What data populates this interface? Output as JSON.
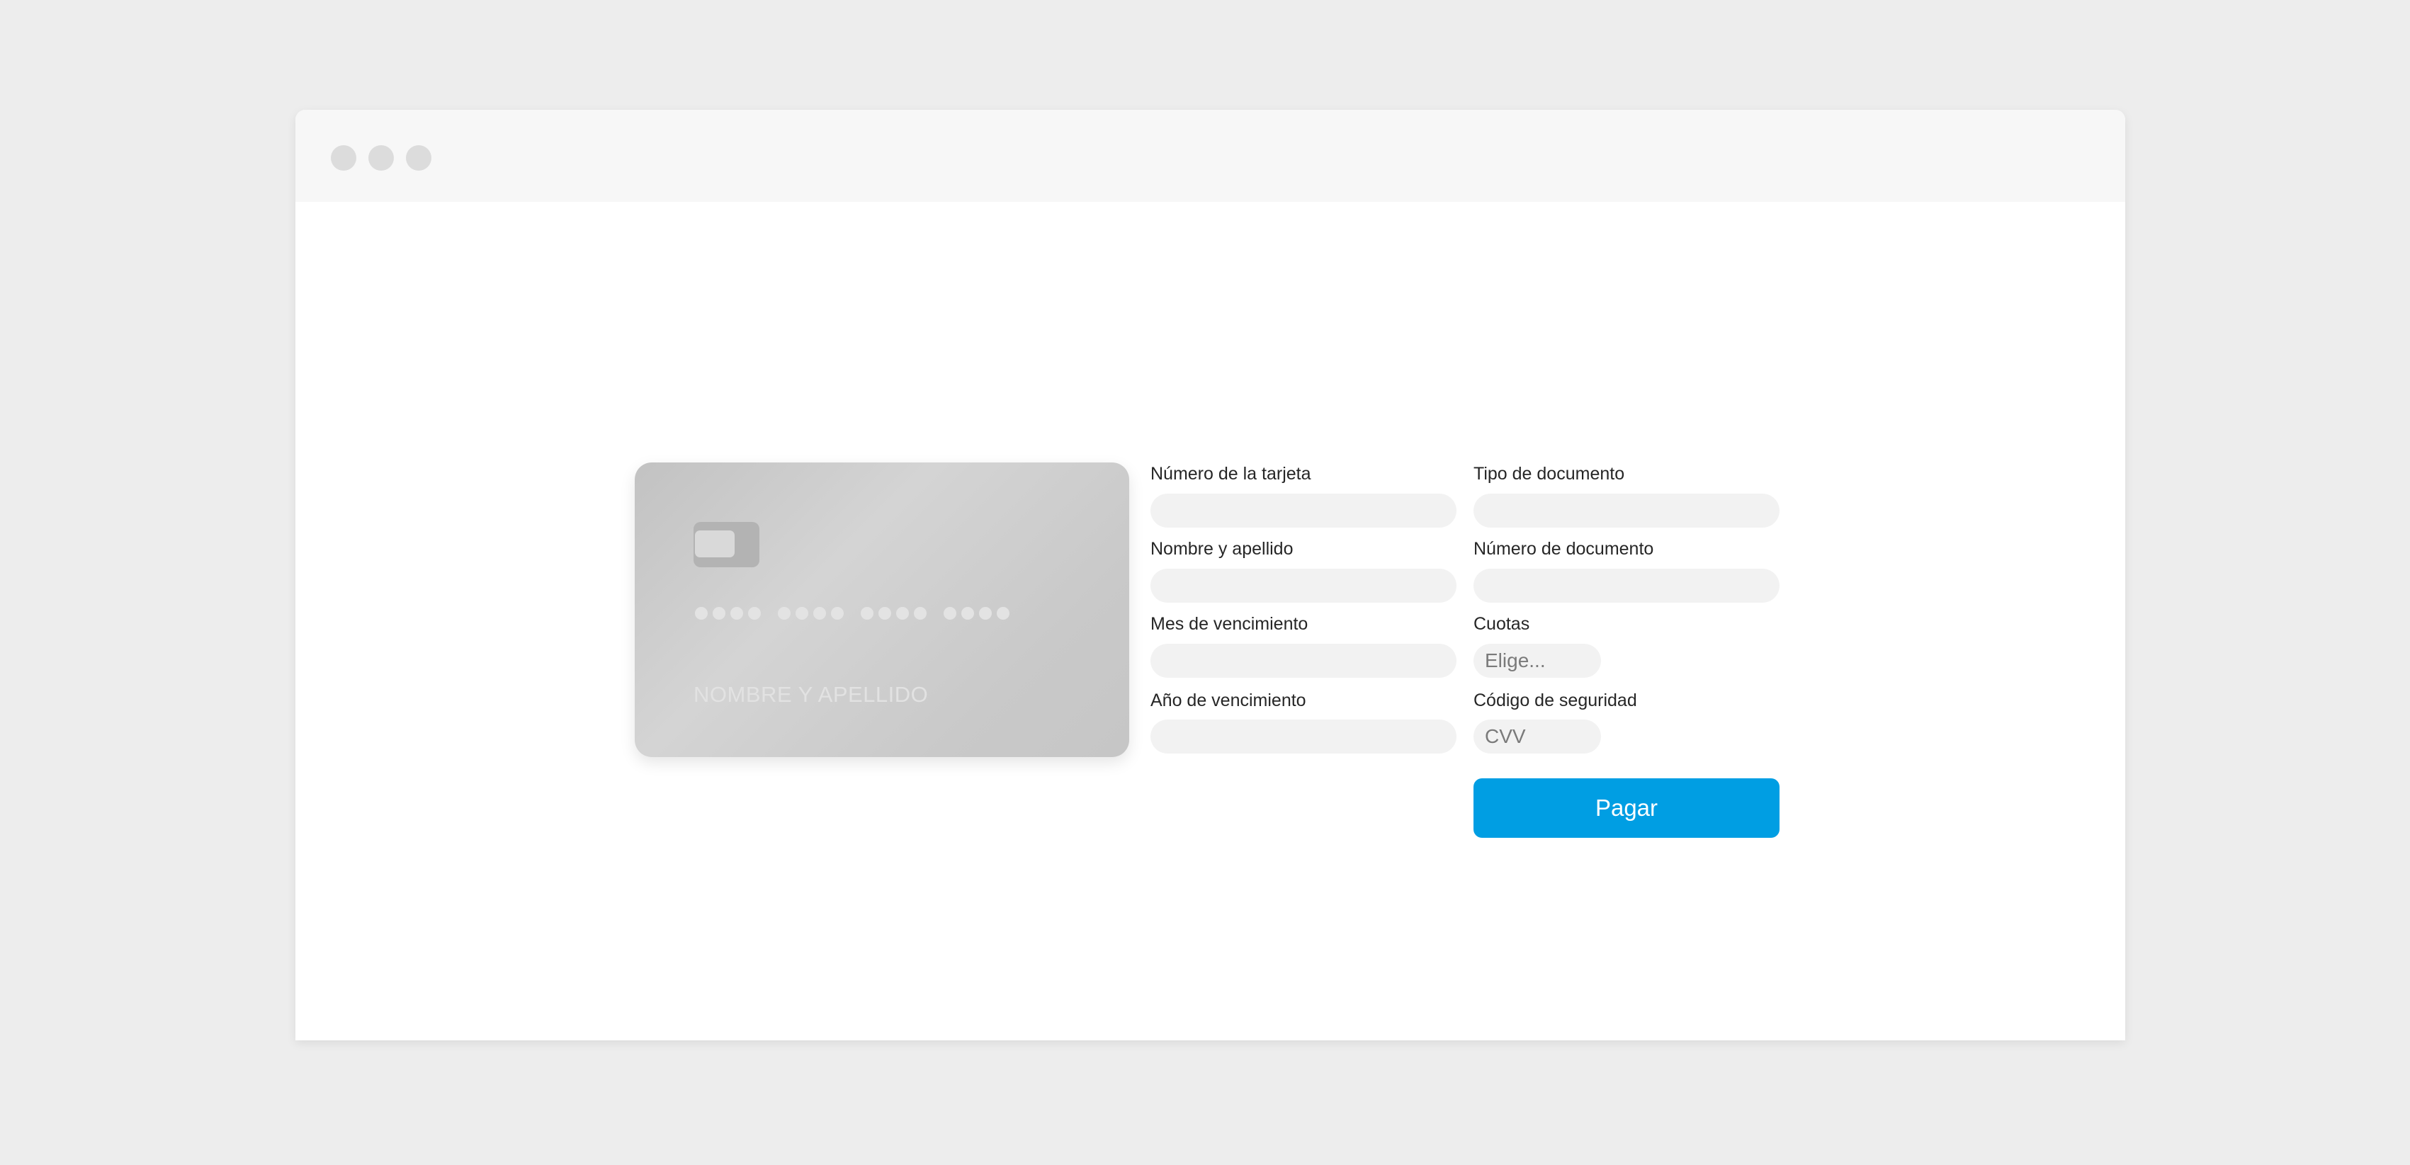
{
  "card": {
    "name_placeholder": "NOMBRE Y APELLIDO"
  },
  "form": {
    "card_number_label": "Número de la tarjeta",
    "document_type_label": "Tipo de documento",
    "cardholder_name_label": "Nombre y apellido",
    "document_number_label": "Número de documento",
    "expiry_month_label": "Mes de vencimiento",
    "installments_label": "Cuotas",
    "installments_value": "Elige...",
    "expiry_year_label": "Año de vencimiento",
    "security_code_label": "Código de seguridad",
    "security_code_placeholder": "CVV"
  },
  "actions": {
    "pay_label": "Pagar"
  },
  "colors": {
    "accent": "#009ee3",
    "card_base": "#c9c9c9",
    "input_bg": "#f2f2f2",
    "page_bg": "#ededed"
  }
}
